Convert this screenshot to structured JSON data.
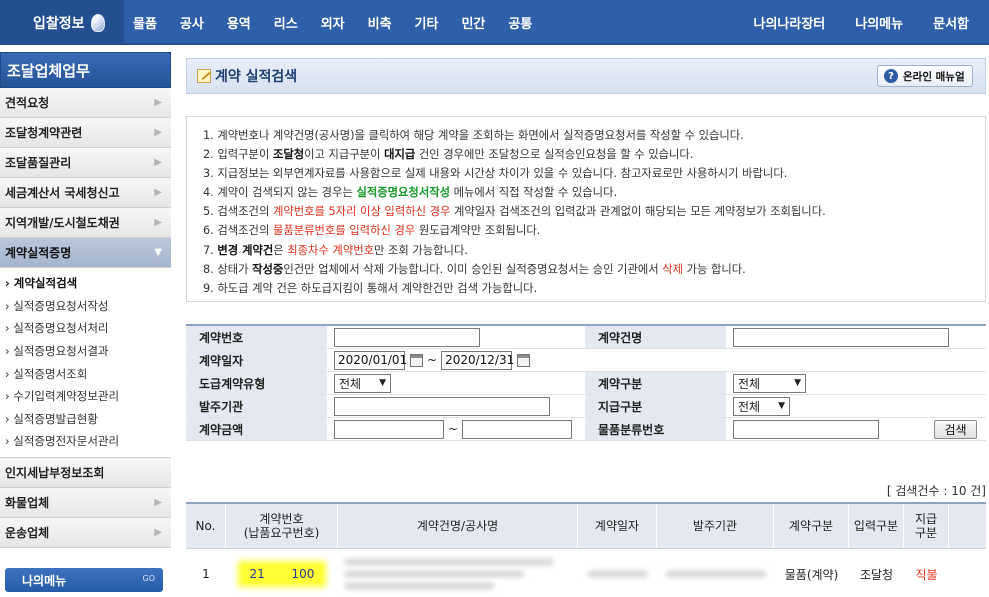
{
  "topnav": {
    "logo": "입찰정보",
    "menu": [
      "물품",
      "공사",
      "용역",
      "리스",
      "외자",
      "비축",
      "기타",
      "민간",
      "공통"
    ],
    "right": [
      "나의나라장터",
      "나의메뉴",
      "문서함"
    ]
  },
  "sidebar": {
    "title": "조달업체업무",
    "items_top": [
      "견적요청",
      "조달청계약관련",
      "조달품질관리",
      "세금계산서 국세청신고",
      "지역개발/도시철도채권"
    ],
    "active": "계약실적증명",
    "sub_items": [
      "계약실적검색",
      "실적증명요청서작성",
      "실적증명요청서처리",
      "실적증명요청서결과",
      "실적증명서조회",
      "수기입력계약정보관리",
      "실적증명발급현황",
      "실적증명전자문서관리"
    ],
    "items_bottom": [
      "인지세납부정보조회",
      "화물업체",
      "운송업체"
    ],
    "mymenu": "나의메뉴",
    "mymenu_go": "GO"
  },
  "page": {
    "title": "계약 실적검색",
    "manual": "온라인 매뉴얼"
  },
  "notice": [
    [
      {
        "t": "1. 계약번호나 계약건명(공사명)을 클릭하여 해당 계약을 조회하는 화면에서 실적증명요청서를 작성할 수 있습니다."
      }
    ],
    [
      {
        "t": "2. 입력구분이 "
      },
      {
        "t": "조달청",
        "c": "b"
      },
      {
        "t": "이고 지급구분이 "
      },
      {
        "t": "대지급",
        "c": "b"
      },
      {
        "t": " 건인 경우에만 조달청으로 실적승인요청을 할 수 있습니다."
      }
    ],
    [
      {
        "t": "3. 지급정보는 외부연계자료를 사용함으로 실제 내용와 시간상 차이가 있을 수 있습니다. 참고자료로만 사용하시기 바랍니다."
      }
    ],
    [
      {
        "t": "4. 계약이 검색되지 않는 경우는 "
      },
      {
        "t": "실적증명요청서작성",
        "c": "g"
      },
      {
        "t": " 메뉴에서 직접 작성할 수 있습니다."
      }
    ],
    [
      {
        "t": "5. 검색조건의 "
      },
      {
        "t": "계약번호를 5자리 이상 입력하신 경우",
        "c": "r"
      },
      {
        "t": " 계약일자 검색조건의 입력값과 관계없이 해당되는 모든 계약정보가 조회됩니다."
      }
    ],
    [
      {
        "t": "6. 검색조건의 "
      },
      {
        "t": "물품분류번호를 입력하신 경우",
        "c": "r"
      },
      {
        "t": " 원도급계약만 조회됩니다."
      }
    ],
    [
      {
        "t": "7. "
      },
      {
        "t": "변경 계약건",
        "c": "b"
      },
      {
        "t": "은 "
      },
      {
        "t": "최종차수 계약번호",
        "c": "r"
      },
      {
        "t": "만 조회 가능합니다."
      }
    ],
    [
      {
        "t": "8. 상태가 "
      },
      {
        "t": "작성중",
        "c": "b"
      },
      {
        "t": "인건만 업체에서 삭제 가능합니다. 이미 승인된 실적증명요청서는 승인 기관에서 "
      },
      {
        "t": "삭제",
        "c": "r"
      },
      {
        "t": " 가능 합니다."
      }
    ],
    [
      {
        "t": "9. 하도급 계약 건은 하도급지킴이 통해서 계약한건만 검색 가능합니다."
      }
    ]
  ],
  "form": {
    "contract_no": "계약번호",
    "contract_name": "계약건명",
    "contract_date": "계약일자",
    "date_from": "2020/01/01",
    "date_to": "2020/12/31",
    "sub_type": "도급계약유형",
    "sub_type_value": "전체",
    "contract_type": "계약구분",
    "contract_type_value": "전체",
    "orderer": "발주기관",
    "pay_type": "지급구분",
    "pay_type_value": "전체",
    "amount": "계약금액",
    "tilde": "~",
    "goods_no": "물품분류번호",
    "search_btn": "검색"
  },
  "result_count": "[  검색건수 : 10 건]",
  "table": {
    "headers": [
      "No.",
      "계약번호\n(납품요구번호)",
      "계약건명/공사명",
      "계약일자",
      "발주기관",
      "계약구분",
      "입력구분",
      "지급\n구분"
    ],
    "rows": [
      {
        "no": "1",
        "contract_no_a": "21",
        "contract_no_b": "100",
        "contract_type": "물품(계약)",
        "input_type": "조달청",
        "pay_type": "직불"
      }
    ]
  }
}
